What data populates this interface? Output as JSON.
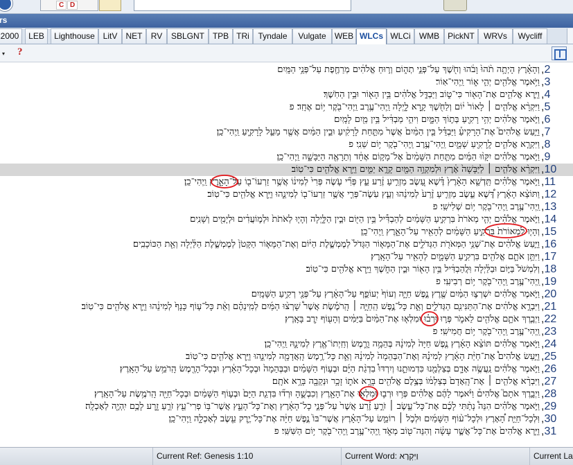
{
  "panel": {
    "title": "rs"
  },
  "tabs": [
    {
      "label": "2000",
      "active": false
    },
    {
      "label": "LEB",
      "active": false
    },
    {
      "label": "Lighthouse",
      "active": false
    },
    {
      "label": "LitV",
      "active": false
    },
    {
      "label": "NET",
      "active": false
    },
    {
      "label": "RV",
      "active": false
    },
    {
      "label": "SBLGNT",
      "active": false
    },
    {
      "label": "TPB",
      "active": false
    },
    {
      "label": "TRi",
      "active": false
    },
    {
      "label": "Tyndale",
      "active": false
    },
    {
      "label": "Vulgate",
      "active": false
    },
    {
      "label": "WEB",
      "active": false
    },
    {
      "label": "WLCs",
      "active": true
    },
    {
      "label": "WLCi",
      "active": false
    },
    {
      "label": "WMB",
      "active": false
    },
    {
      "label": "PickNT",
      "active": false
    },
    {
      "label": "WRVs",
      "active": false
    },
    {
      "label": "Wycliff",
      "active": false
    }
  ],
  "subbar": {
    "dropdown_glyph": "▾",
    "help_glyph": "?"
  },
  "toolbar": {
    "c_label": "C",
    "d_label": "D"
  },
  "verses": [
    {
      "num": "2",
      "text": "וְהָאָ֗רֶץ הָיְתָ֥ה תֹ֨הוּ֙ וָבֹ֔הוּ וְחֹ֖שֶׁךְ עַל־פְּנֵ֣י תְה֑וֹם וְר֣וּחַ אֱלֹהִ֔ים מְרַחֶ֖פֶת עַל־פְּנֵ֥י הַמָּֽיִם׃"
    },
    {
      "num": "3",
      "text": "וַיֹּ֥אמֶר אֱלֹהִ֖ים יְהִ֣י א֑וֹר וַֽיְהִי־אֽוֹר׃"
    },
    {
      "num": "4",
      "text": "וַיַּ֧רְא אֱלֹהִ֛ים אֶת־הָא֖וֹר כִּי־ט֑וֹב וַיַּבְדֵּ֣ל אֱלֹהִ֔ים בֵּ֥ין הָא֖וֹר וּבֵ֥ין הַחֹֽשֶׁךְ׃"
    },
    {
      "num": "5",
      "text": "וַיִּקְרָ֨א אֱלֹהִ֤ים ׀ לָאוֹר֙ י֔וֹם וְלַחֹ֖שֶׁךְ קָ֣רָא לָ֑יְלָה וַֽיְהִי־עֶ֥רֶב וַֽיְהִי־בֹ֖קֶר י֥וֹם אֶחָֽד׃ פ"
    },
    {
      "num": "6",
      "text": "וַיֹּ֣אמֶר אֱלֹהִ֔ים יְהִ֥י רָקִ֖יעַ בְּת֣וֹךְ הַמָּ֑יִם וִיהִ֣י מַבְדִּ֔יל בֵּ֥ין מַ֖יִם לָמָֽיִם׃"
    },
    {
      "num": "7",
      "text": "וַיַּ֣עַשׂ אֱלֹהִים֮ אֶת־הָרָקִיעַ֒ וַיַּבְדֵּ֗ל בֵּ֤ין הַמַּ֨יִם֙ אֲשֶׁר֙ מִתַּ֣חַת לָרָקִ֔יעַ וּבֵ֣ין הַמַּ֔יִם אֲשֶׁ֖ר מֵעַ֣ל לָרָקִ֑יעַ וַֽיְהִי־כֵֽן׃"
    },
    {
      "num": "8",
      "text": "וַיִּקְרָ֧א אֱלֹהִ֛ים לָֽרָקִ֖יעַ שָׁמָ֑יִם וַֽיְהִי־עֶ֥רֶב וַֽיְהִי־בֹ֖קֶר י֥וֹם שֵׁנִֽי׃ פ"
    },
    {
      "num": "9",
      "text": "וַיֹּ֣אמֶר אֱלֹהִ֗ים יִקָּו֨וּ הַמַּ֜יִם מִתַּ֤חַת הַשָּׁמַ֨יִם֙ אֶל־מָק֣וֹם אֶחָ֔ד וְתֵרָאֶ֖ה הַיַּבָּשָׁ֑ה וַֽיְהִי־כֵֽן׃"
    },
    {
      "num": "10",
      "text": "וַיִּקְרָ֨א אֱלֹהִ֤ים ׀ לַיַּבָּשָׁה֙ אֶ֔רֶץ וּלְמִקְוֵ֥ה הַמַּ֖יִם קָרָ֣א יַמִּ֑ים וַיַּ֥רְא אֱלֹהִ֖ים כִּי־טֽוֹב׃",
      "current": true
    },
    {
      "num": "11",
      "text": "וַיֹּ֣אמֶר אֱלֹהִ֗ים תַּֽדְשֵׁ֤א הָאָ֨רֶץ֙ דֶּ֗שֶׁא עֵ֚שֶׂב מַזְרִ֣יעַ זֶ֔רַע עֵ֣ץ פְּרִ֞י עֹ֤שֶׂה פְּרִי֙ לְמִינ֔וֹ אֲשֶׁ֥ר זַרְעוֹ־ב֖וֹ עַל־הָאָ֑רֶץ וַֽיְהִי־כֵֽן׃"
    },
    {
      "num": "12",
      "text": "וַתּוֹצֵ֨א הָאָ֜רֶץ דֶּ֠שֶׁא עֵ֣שֶׂב מַזְרִ֤יעַ זֶ֨רַע֙ לְמִינֵ֔הוּ וְעֵ֧ץ עֹֽשֶׂה־פְּרִ֛י אֲשֶׁ֥ר זַרְעוֹ־ב֖וֹ לְמִינֵ֑הוּ וַיַּ֥רְא אֱלֹהִ֖ים כִּי־טֽוֹב׃"
    },
    {
      "num": "13",
      "text": "וַֽיְהִי־עֶ֥רֶב וַֽיְהִי־בֹ֖קֶר י֥וֹם שְׁלִישִֽׁי׃ פ"
    },
    {
      "num": "14",
      "text": "וַיֹּ֣אמֶר אֱלֹהִ֗ים יְהִ֤י מְאֹרֹת֙ בִּרְקִ֣יעַ הַשָּׁמַ֔יִם לְהַבְדִּ֕יל בֵּ֥ין הַיּ֖וֹם וּבֵ֣ין הַלָּ֑יְלָה וְהָי֤וּ לְאֹתֹת֙ וּלְמ֣וֹעֲדִ֔ים וּלְיָמִ֖ים וְשָׁנִֽים׃"
    },
    {
      "num": "15",
      "text": "וְהָי֤וּ לִמְאוֹרֹת֙ בִּרְקִ֣יעַ הַשָּׁמַ֔יִם לְהָאִ֖יר עַל־הָאָ֑רֶץ וַֽיְהִי־כֵֽן׃"
    },
    {
      "num": "16",
      "text": "וַיַּ֣עַשׂ אֱלֹהִ֔ים אֶת־שְׁנֵ֥י הַמְּאֹרֹ֖ת הַגְּדֹלִ֑ים אֶת־הַמָּא֤וֹר הַגָּדֹל֙ לְמֶמְשֶׁ֣לֶת הַיּ֔וֹם וְאֶת־הַמָּא֤וֹר הַקָּטֹן֙ לְמֶמְשֶׁ֣לֶת הַלַּ֔יְלָה וְאֵ֖ת הַכּוֹכָבִֽים׃"
    },
    {
      "num": "17",
      "text": "וַיִּתֵּ֥ן אֹתָ֛ם אֱלֹהִ֖ים בִּרְקִ֣יעַ הַשָּׁמָ֑יִם לְהָאִ֖יר עַל־הָאָֽרֶץ׃"
    },
    {
      "num": "18",
      "text": "וְלִמְשֹׁל֙ בַּיּ֣וֹם וּבַלַּ֔יְלָה וּֽלֲהַבְדִּ֔יל בֵּ֥ין הָא֖וֹר וּבֵ֣ין הַחֹ֑שֶׁךְ וַיַּ֥רְא אֱלֹהִ֖ים כִּי־טֽוֹב׃"
    },
    {
      "num": "19",
      "text": "וַֽיְהִי־עֶ֥רֶב וַֽיְהִי־בֹ֖קֶר י֥וֹם רְבִיעִֽי׃ פ"
    },
    {
      "num": "20",
      "text": "וַיֹּ֣אמֶר אֱלֹהִ֔ים יִשְׁרְצ֣וּ הַמַּ֔יִם שֶׁ֖רֶץ נֶ֣פֶשׁ חַיָּ֑ה וְעוֹף֙ יְעוֹפֵ֣ף עַל־הָאָ֔רֶץ עַל־פְּנֵ֖י רְקִ֥יעַ הַשָּׁמָֽיִם׃"
    },
    {
      "num": "21",
      "text": "וַיִּבְרָ֣א אֱלֹהִ֔ים אֶת־הַתַּנִּינִ֖ם הַגְּדֹלִ֑ים וְאֵ֣ת כָּל־נֶ֣פֶשׁ הַֽחַיָּ֣ה ׀ הָֽרֹמֶ֡שֶׂת אֲשֶׁר֩ שָׁרְצ֨וּ הַמַּ֜יִם לְמִֽינֵהֶ֗ם וְאֵ֨ת כָּל־ע֤וֹף כָּנָף֙ לְמִינֵ֔הוּ וַיַּ֥רְא אֱלֹהִ֖ים כִּי־טֽוֹב׃"
    },
    {
      "num": "22",
      "text": "וַיְבָ֧רֶךְ אֹתָ֛ם אֱלֹהִ֖ים לֵאמֹ֑ר פְּר֣וּ וּרְב֗וּ וּמִלְא֤וּ אֶת־הַמַּ֨יִם֙ בַּיַּמִּ֔ים וְהָע֖וֹף יִ֥רֶב בָּאָֽרֶץ׃"
    },
    {
      "num": "23",
      "text": "וַֽיְהִי־עֶ֥רֶב וַֽיְהִי־בֹ֖קֶר י֥וֹם חֲמִישִֽׁי׃ פ"
    },
    {
      "num": "24",
      "text": "וַיֹּ֣אמֶר אֱלֹהִ֗ים תּוֹצֵ֨א הָאָ֜רֶץ נֶ֤פֶשׁ חַיָּה֙ לְמִינָ֔הּ בְּהֵמָ֥ה וָרֶ֛מֶשׂ וְחַֽיְתוֹ־אֶ֖רֶץ לְמִינָ֑הּ וַֽיְהִי־כֵֽן׃"
    },
    {
      "num": "25",
      "text": "וַיַּ֣עַשׂ אֱלֹהִים֩ אֶת־חַיַּ֨ת הָאָ֜רֶץ לְמִינָ֗הּ וְאֶת־הַבְּהֵמָה֙ לְמִינָ֔הּ וְאֵ֛ת כָּל־רֶ֥מֶשׂ הָֽאֲדָמָ֖ה לְמִינֵ֑הוּ וַיַּ֥רְא אֱלֹהִ֖ים כִּי־טֽוֹב׃"
    },
    {
      "num": "26",
      "text": "וַיֹּ֣אמֶר אֱלֹהִ֔ים נַֽעֲשֶׂ֥ה אָדָ֛ם בְּצַלְמֵ֖נוּ כִּדְמוּתֵ֑נוּ וְיִרְדּוּ֩ בִדְגַ֨ת הַיָּ֜ם וּבְע֣וֹף הַשָּׁמַ֗יִם וּבַבְּהֵמָה֙ וּבְכָל־הָאָ֔רֶץ וּבְכָל־הָרֶ֖מֶשׂ הָֽרֹמֵ֥שׂ עַל־הָאָֽרֶץ׃"
    },
    {
      "num": "27",
      "text": "וַיִּבְרָ֨א אֱלֹהִ֤ים ׀ אֶת־הָֽאָדָם֙ בְּצַלְמ֔וֹ בְּצֶ֥לֶם אֱלֹהִ֖ים בָּרָ֣א אֹת֑וֹ זָכָ֥ר וּנְקֵבָ֖ה בָּרָ֥א אֹתָֽם׃"
    },
    {
      "num": "28",
      "text": "וַיְבָ֣רֶךְ אֹתָם֮ אֱלֹהִים֒ וַיֹּ֨אמֶר לָהֶ֜ם אֱלֹהִ֗ים פְּר֥וּ וּרְב֛וּ וּמִלְא֥וּ אֶת־הָאָ֖רֶץ וְכִבְשֻׁ֑הָ וּרְד֞וּ בִּדְגַ֤ת הַיָּם֙ וּבְע֣וֹף הַשָּׁמַ֔יִם וּבְכָל־חַיָּ֖ה הָֽרֹמֶ֥שֶׂת עַל־הָאָֽרֶץ׃"
    },
    {
      "num": "29",
      "text": "וַיֹּ֣אמֶר אֱלֹהִ֗ים הִנֵּה֩ נָתַ֨תִּי לָכֶ֜ם אֶת־כָּל־עֵ֣שֶׂב ׀ זֹרֵ֣עַ זֶ֗רַע אֲשֶׁר֙ עַל־פְּנֵ֣י כָל־הָאָ֔רֶץ וְאֶת־כָּל־הָעֵ֛ץ אֲשֶׁר־בּ֥וֹ פְרִי־עֵ֖ץ זֹרֵ֣עַ זָ֑רַע לָכֶ֥ם יִֽהְיֶ֖ה לְאָכְלָֽה׃"
    },
    {
      "num": "30",
      "text": "וּֽלְכָל־חַיַּ֣ת הָ֠אָרֶץ וּלְכָל־ע֨וֹף הַשָּׁמַ֜יִם וּלְכֹ֣ל ׀ רוֹמֵ֣שׂ עַל־הָאָ֗רֶץ אֲשֶׁר־בּוֹ֙ נֶ֣פֶשׁ חַיָּ֔ה אֶת־כָּל־יֶ֥רֶק עֵ֖שֶׂב לְאָכְלָ֑ה וַֽיְהִי־כֵֽן׃"
    },
    {
      "num": "31",
      "text": "וַיַּ֤רְא אֱלֹהִים֙ אֶת־כָּל־אֲשֶׁ֣ר עָשָׂ֔ה וְהִנֵּה־ט֖וֹב מְאֹ֑ד וַֽיְהִי־עֶ֥רֶב וַֽיְהִי־בֹ֖קֶר י֥וֹם הַשִּׁשִּֽׁי׃ פ"
    }
  ],
  "status": {
    "current_ref": "Current Ref: Genesis 1:10",
    "current_word": "Current Word: וַיִּקְרָא",
    "current_layout": "Current Layout"
  },
  "annotation_color": "#e0161b",
  "current_verse_bg": "#d6d6d6"
}
